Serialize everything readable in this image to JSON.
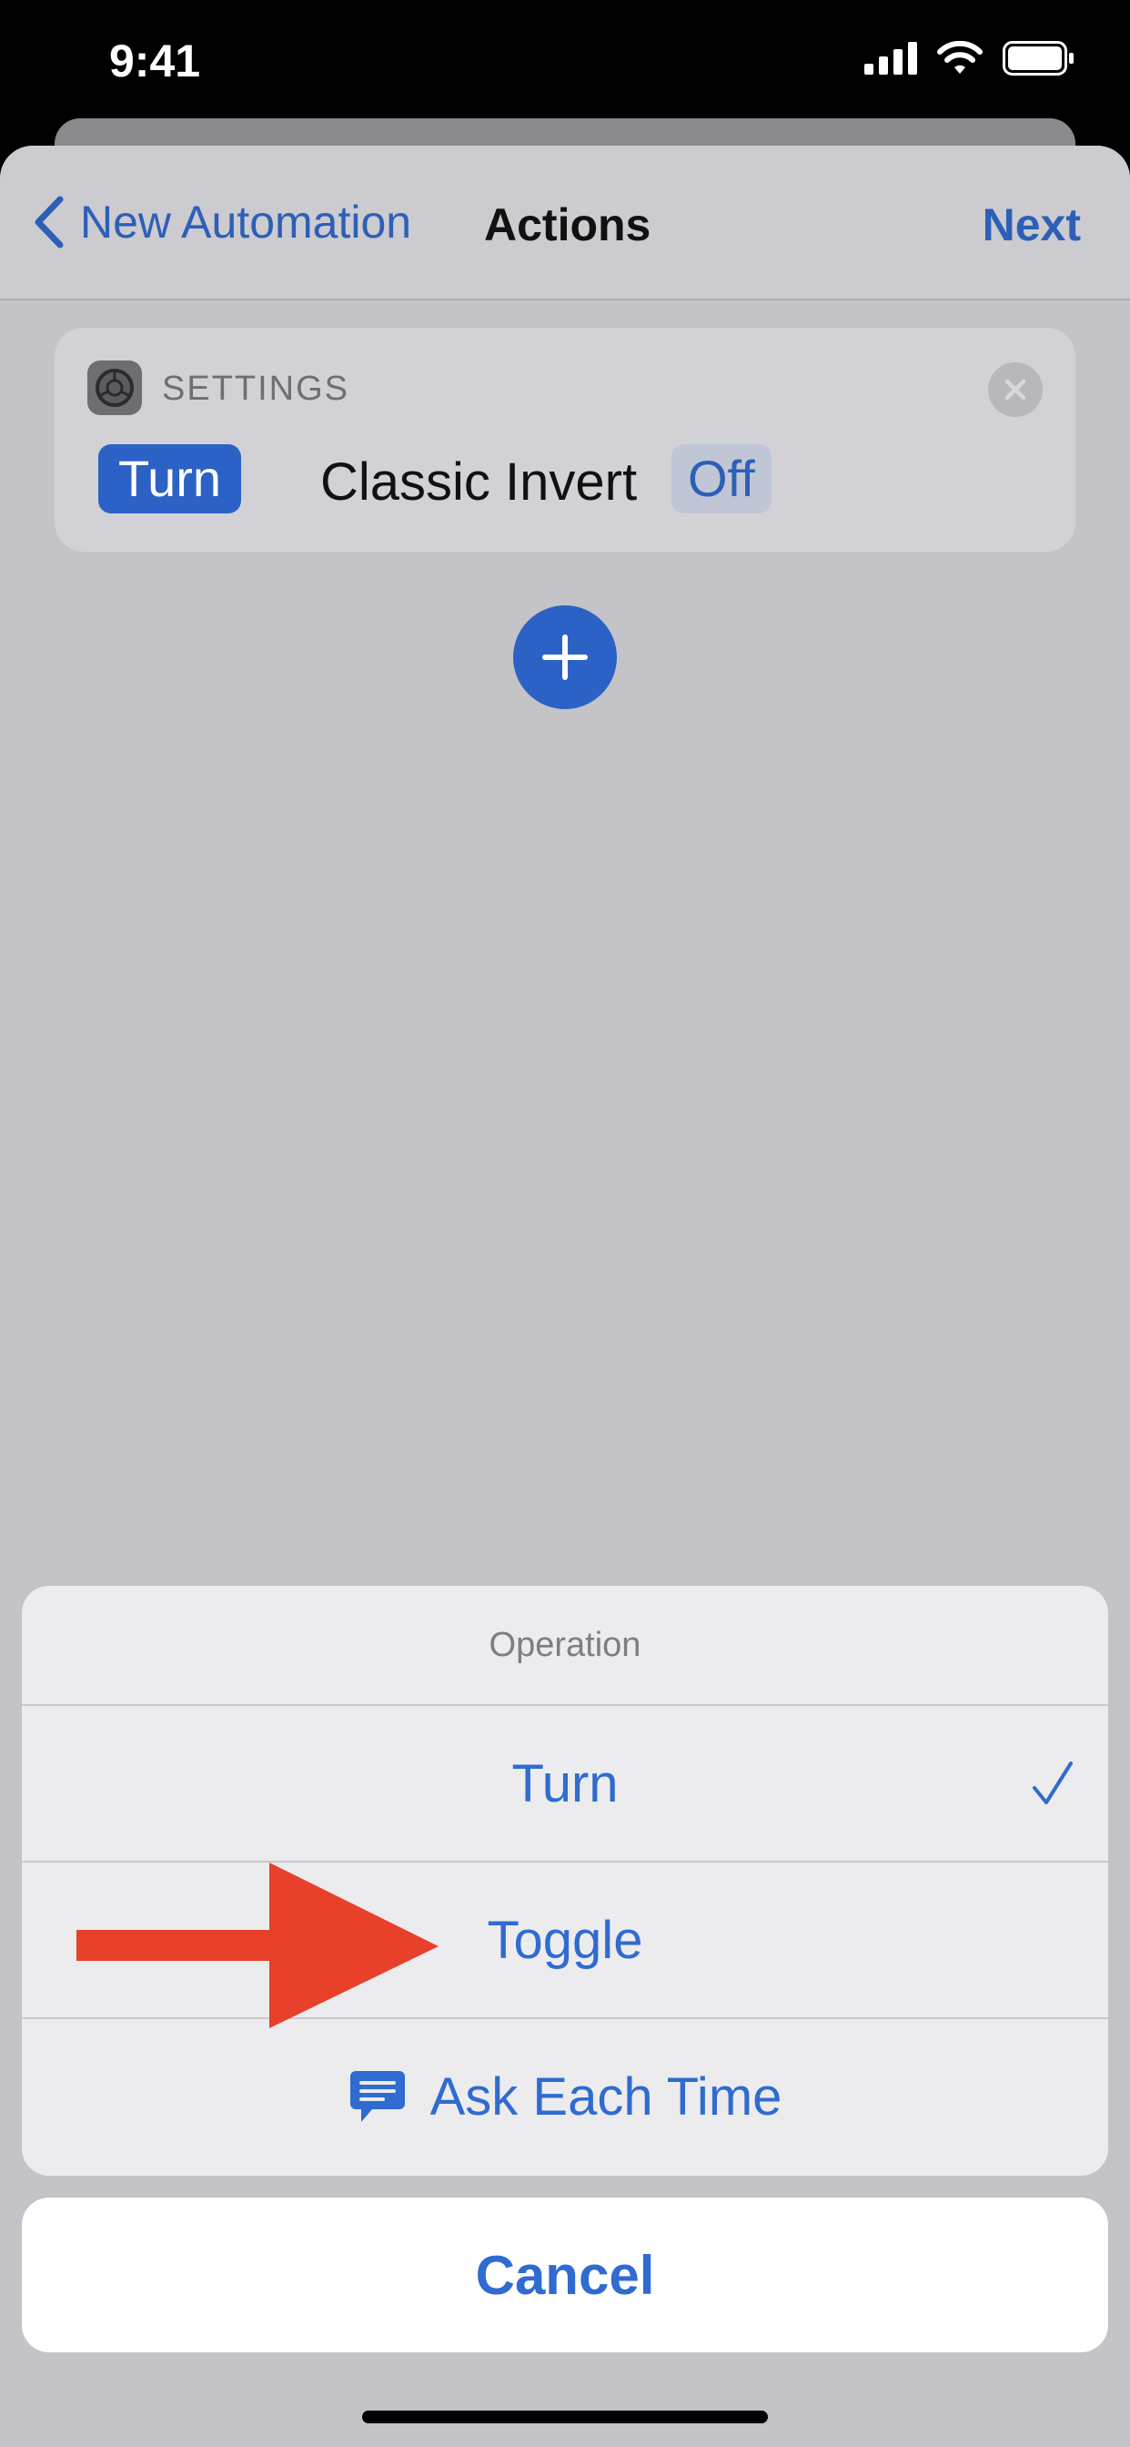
{
  "status_bar": {
    "time": "9:41"
  },
  "nav": {
    "back_label": "New Automation",
    "title": "Actions",
    "next_label": "Next"
  },
  "action_card": {
    "app_label": "SETTINGS",
    "verb_token": "Turn",
    "setting_name": "Classic Invert",
    "state_token": "Off"
  },
  "action_sheet": {
    "title": "Operation",
    "options": [
      {
        "label": "Turn",
        "selected": true
      },
      {
        "label": "Toggle",
        "selected": false
      },
      {
        "label": "Ask Each Time",
        "selected": false
      }
    ],
    "cancel_label": "Cancel"
  },
  "colors": {
    "accent": "#2f6bd0",
    "annotation_arrow": "#e8402a"
  },
  "icons": [
    "chevron-left-icon",
    "settings-gear-icon",
    "close-icon",
    "plus-icon",
    "checkmark-icon",
    "chat-bubble-icon",
    "cellular-icon",
    "wifi-icon",
    "battery-icon"
  ]
}
